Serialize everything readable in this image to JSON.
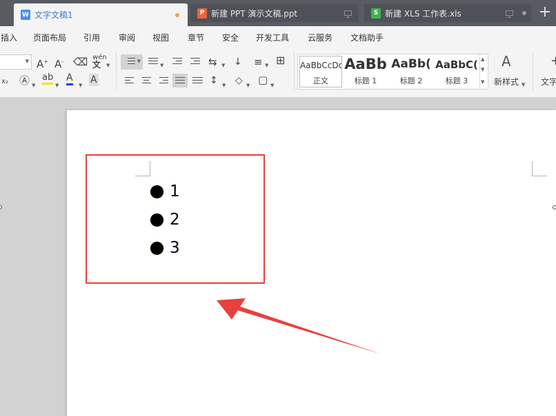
{
  "tabs": [
    {
      "label": "文字文稿1",
      "icon": "W",
      "color": "#4a90e2",
      "active": true
    },
    {
      "label": "新建 PPT 演示文稿.ppt",
      "icon": "P",
      "color": "#e8643c",
      "active": false
    },
    {
      "label": "新建 XLS 工作表.xls",
      "icon": "S",
      "color": "#3fb34f",
      "active": false
    }
  ],
  "new_tab": "+",
  "menu": [
    "插入",
    "页面布局",
    "引用",
    "审阅",
    "视图",
    "章节",
    "安全",
    "开发工具",
    "云服务",
    "文档助手"
  ],
  "ribbon": {
    "style_gallery": [
      {
        "sample": "AaBbCcDd",
        "name": "正文"
      },
      {
        "sample": "AaBb",
        "name": "标题 1"
      },
      {
        "sample": "AaBb(",
        "name": "标题 2"
      },
      {
        "sample": "AaBbC(",
        "name": "标题 3"
      }
    ],
    "new_style": "新样式",
    "text_tool": "文字"
  },
  "document": {
    "list_items": [
      "1",
      "2",
      "3"
    ]
  },
  "colors": {
    "highlight": "#e8403f",
    "active_tab_text": "#3a7bd5"
  }
}
